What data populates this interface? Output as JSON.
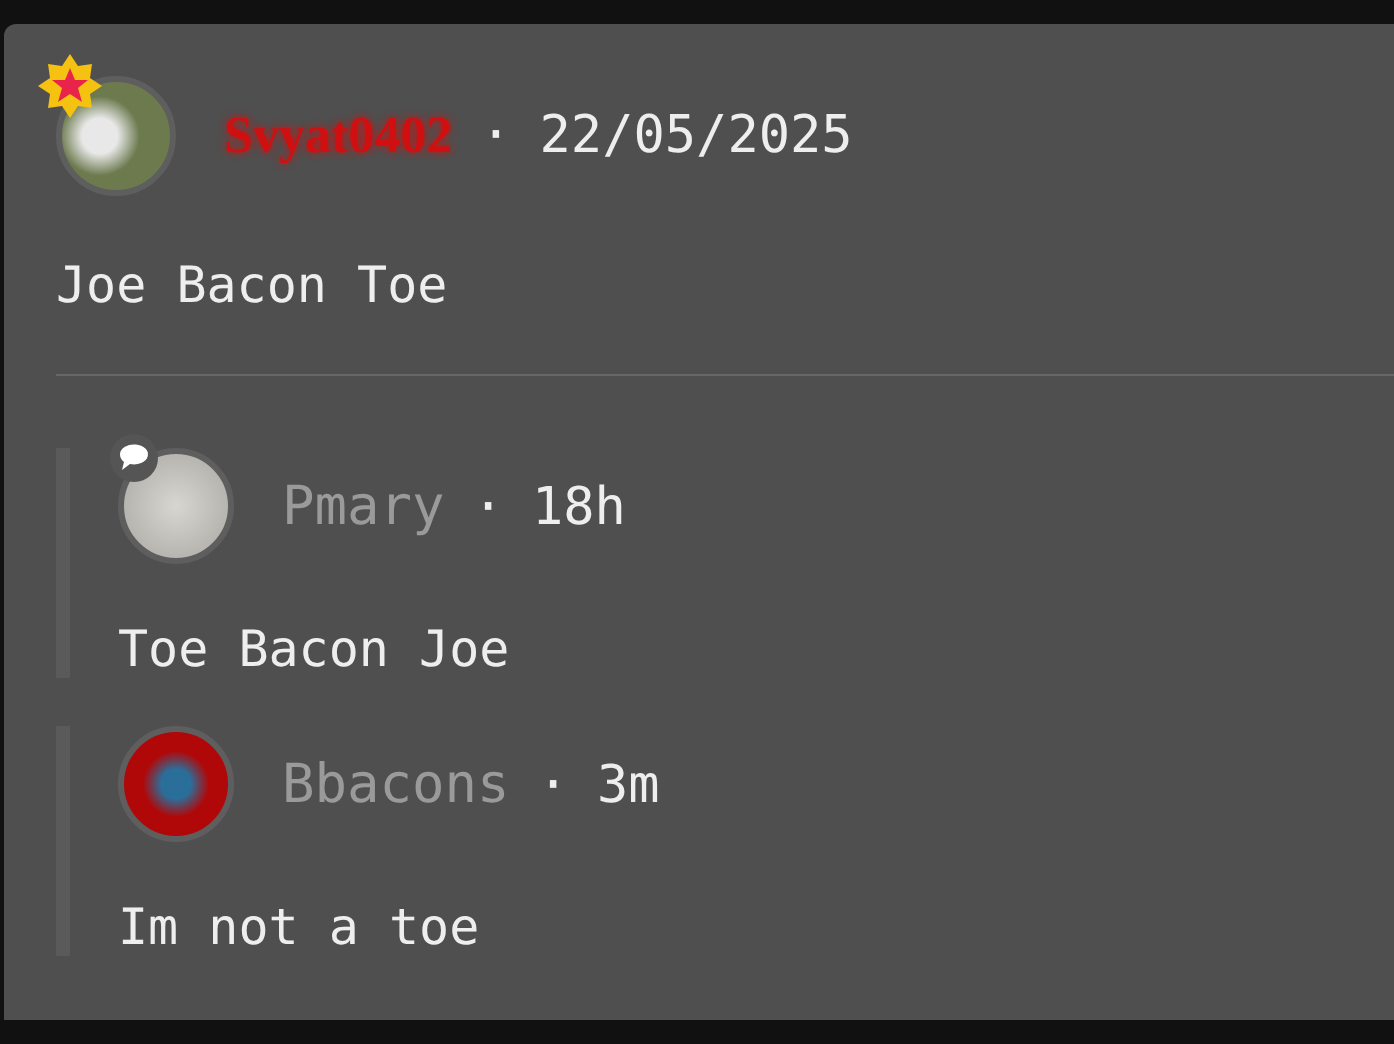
{
  "post": {
    "author": {
      "name": "Svyat0402",
      "color": "#d01010"
    },
    "badge": {
      "kind": "star"
    },
    "separator": "·",
    "date": "22/05/2025",
    "body": "Joe Bacon Toe"
  },
  "replies": [
    {
      "author": {
        "name": "Pmary",
        "color": "#9a9a9a"
      },
      "badge": {
        "kind": "chat"
      },
      "separator": "·",
      "time": "18h",
      "body": "Toe Bacon Joe"
    },
    {
      "author": {
        "name": "Bbacons",
        "color": "#9a9a9a"
      },
      "separator": "·",
      "time": "3m",
      "body": "Im not a toe"
    }
  ]
}
